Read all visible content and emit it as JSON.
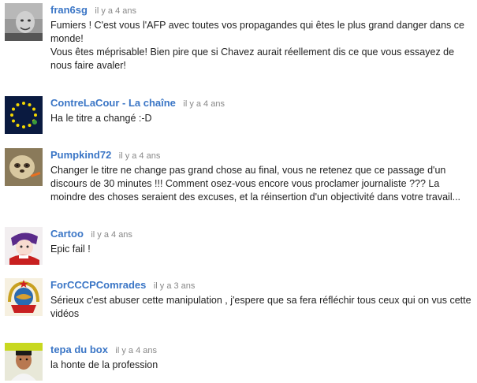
{
  "comments": [
    {
      "author": "fran6sg",
      "time": "il y a 4 ans",
      "avatar_icon": "user-photo-icon",
      "lines": [
        "Fumiers ! C'est vous l'AFP avec toutes vos propagandes qui êtes le plus grand danger dans ce monde!",
        "Vous êtes méprisable! Bien pire que si Chavez aurait réellement dis ce que vous essayez de nous faire avaler!"
      ]
    },
    {
      "author": "ContreLaCour - La chaîne",
      "time": "il y a 4 ans",
      "avatar_icon": "eu-stars-icon",
      "lines": [
        "Ha le titre a changé :-D"
      ]
    },
    {
      "author": "Pumpkind72",
      "time": "il y a 4 ans",
      "avatar_icon": "sloth-photo-icon",
      "lines": [
        "Changer le titre ne change pas grand chose au final, vous ne retenez que ce passage d'un discours de 30 minutes !!! Comment osez-vous encore vous proclamer journaliste ??? La moindre des choses seraient des excuses, et la réinsertion d'un objectivité dans votre travail..."
      ]
    },
    {
      "author": "Cartoo",
      "time": "il y a 4 ans",
      "avatar_icon": "anime-character-icon",
      "lines": [
        "Epic fail !"
      ]
    },
    {
      "author": "ForCCCPComrades",
      "time": "il y a 3 ans",
      "avatar_icon": "soviet-emblem-icon",
      "lines": [
        "Sérieux c'est abuser cette manipulation , j'espere que sa fera réfléchir tous ceux qui on vus cette vidéos"
      ]
    },
    {
      "author": "tepa du box",
      "time": "il y a 4 ans",
      "avatar_icon": "man-photo-icon",
      "lines": [
        "la honte de la profession"
      ]
    }
  ]
}
